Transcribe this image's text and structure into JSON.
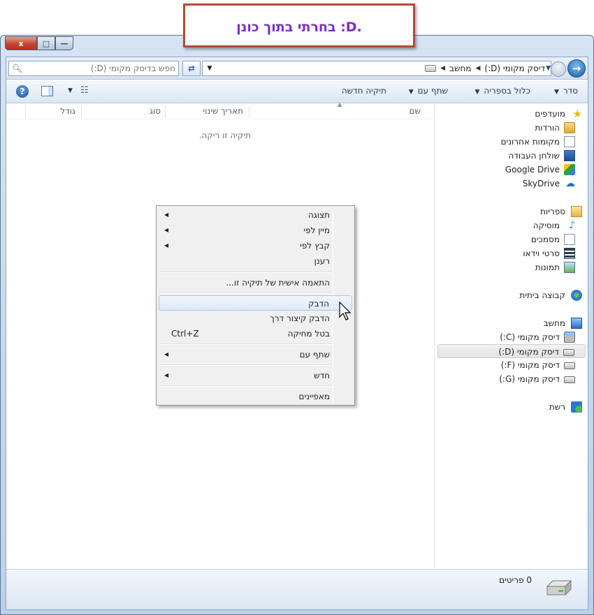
{
  "annotation": {
    "text": "בחרתי בתוך כונן :D."
  },
  "window": {
    "caption": {
      "close": "x",
      "max": "□",
      "min": "—"
    }
  },
  "address": {
    "crumbs": [
      "מחשב",
      "דיסק מקומי (D:)"
    ],
    "search_placeholder": "חפש בדיסק מקומי (D:)"
  },
  "toolbar": {
    "organize": "סדר",
    "include_library": "כלול בספריה",
    "share_with": "שתף עם",
    "new_folder": "תיקיה חדשה"
  },
  "nav_pane": {
    "favorites": "מועדפים",
    "downloads": "הורדות",
    "recent": "מקומות אחרונים",
    "desktop": "שולחן העבודה",
    "google_drive": "Google Drive",
    "skydrive": "SkyDrive",
    "libraries": "ספריות",
    "music": "מוסיקה",
    "documents": "מסמכים",
    "videos": "סרטי וידאו",
    "pictures": "תמונות",
    "homegroup": "קבוצה ביתית",
    "computer": "מחשב",
    "drive_c": "דיסק מקומי (C:)",
    "drive_d": "דיסק מקומי (D:)",
    "drive_f": "דיסק מקומי (F:)",
    "drive_g": "דיסק מקומי (G:)",
    "network": "רשת",
    "selected": "drive_d"
  },
  "columns": {
    "name": "שם",
    "date_modified": "תאריך שינוי",
    "type": "סוג",
    "size": "גודל"
  },
  "empty_message": "תיקיה זו ריקה.",
  "context_menu": {
    "view": "תצוגה",
    "sort_by": "מיין לפי",
    "group_by": "קבץ לפי",
    "refresh": "רענן",
    "customize": "התאמה אישית של תיקיה זו...",
    "paste": "הדבק",
    "paste_shortcut": "הדבק קיצור דרך",
    "undo_delete": "בטל מחיקה",
    "undo_shortcut": "Ctrl+Z",
    "share_with": "שתף עם",
    "new": "חדש",
    "properties": "מאפיינים",
    "highlighted": "paste"
  },
  "details_pane": {
    "item_count": "0 פריטים"
  },
  "colors": {
    "annotation_border": "#b5483a",
    "annotation_text": "#7a2fc6",
    "frame": "#bcd0e8",
    "menu_bg": "#f0f0f0",
    "menu_highlight": "#dfeafa"
  }
}
